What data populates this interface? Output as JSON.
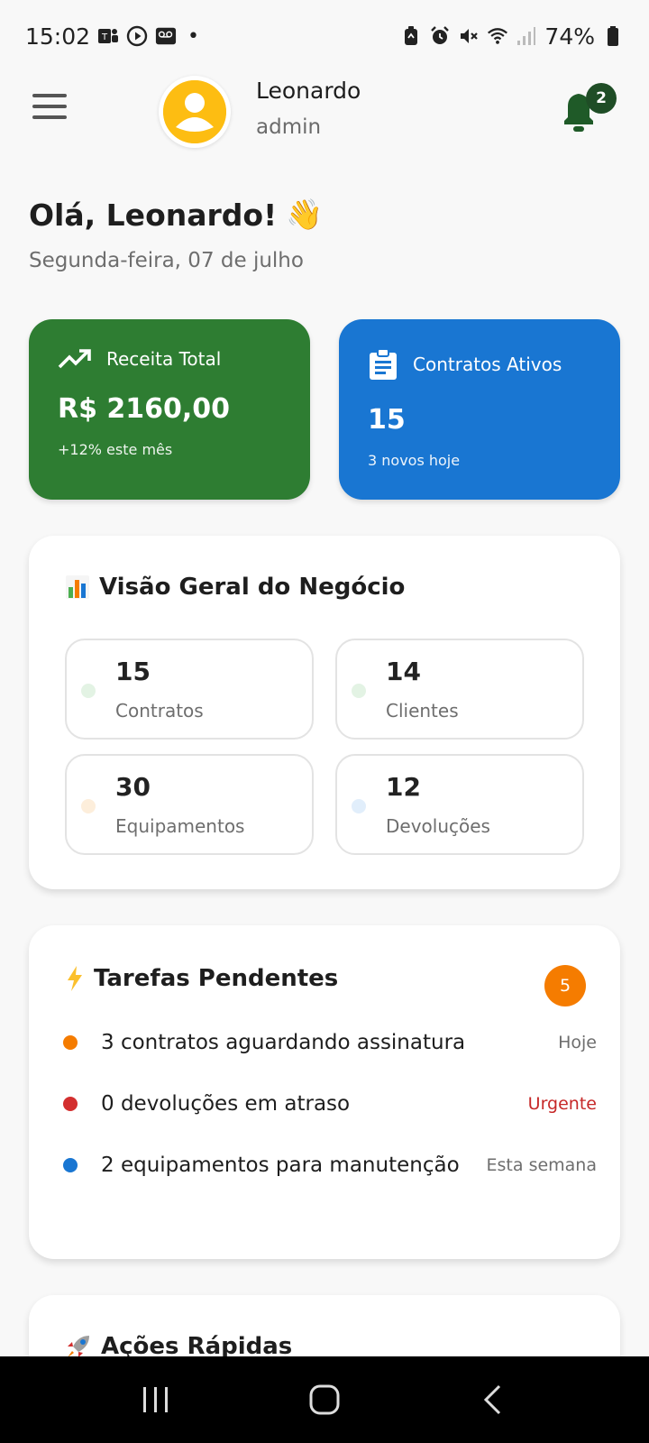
{
  "status_bar": {
    "time": "15:02",
    "battery": "74%",
    "left_icons": [
      "teams-icon",
      "play-icon",
      "voicemail-icon"
    ],
    "right_icons": [
      "battery-saver-icon",
      "alarm-icon",
      "mute-icon",
      "wifi-icon",
      "signal-icon",
      "battery-icon"
    ]
  },
  "header": {
    "user_name": "Leonardo",
    "user_role": "admin",
    "notification_count": "2",
    "bell_color": "#1f5a28"
  },
  "greeting": {
    "title": "Olá, Leonardo!",
    "emoji": "👋",
    "date": "Segunda-feira, 07 de julho"
  },
  "stats": [
    {
      "label": "Receita Total",
      "value": "R$ 2160,00",
      "sub": "+12% este mês",
      "icon": "trending-up-icon",
      "color": "#2e7d32"
    },
    {
      "label": "Contratos Ativos",
      "value": "15",
      "sub": "3 novos hoje",
      "icon": "clipboard-icon",
      "color": "#1976d2"
    }
  ],
  "overview": {
    "title": "Visão Geral do Negócio",
    "items": [
      {
        "number": "15",
        "label": "Contratos",
        "dot_color": "#e3f3e4"
      },
      {
        "number": "14",
        "label": "Clientes",
        "dot_color": "#e3f3e4"
      },
      {
        "number": "30",
        "label": "Equipamentos",
        "dot_color": "#fdeedb"
      },
      {
        "number": "12",
        "label": "Devoluções",
        "dot_color": "#e1eefb"
      }
    ]
  },
  "tasks": {
    "title": "Tarefas Pendentes",
    "count": "5",
    "items": [
      {
        "text": "3 contratos aguardando assinatura",
        "when": "Hoje",
        "dot_color": "#f57c00"
      },
      {
        "text": "0 devoluções em atraso",
        "when": "Urgente",
        "dot_color": "#d32f2f"
      },
      {
        "text": "2 equipamentos para manutenção",
        "when": "Esta semana",
        "dot_color": "#1976d2"
      }
    ]
  },
  "actions": {
    "title": "Ações Rápidas"
  },
  "nav": [
    "recent-apps-icon",
    "home-icon",
    "back-icon"
  ]
}
